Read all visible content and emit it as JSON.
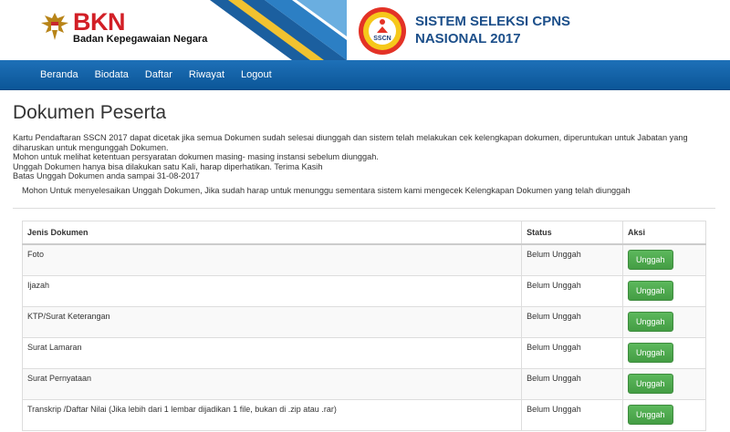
{
  "header": {
    "brand": "BKN",
    "brand_sub": "Badan Kepegawaian Negara",
    "sscn_logo_text": "SSCN",
    "title_line1": "SISTEM SELEKSI CPNS",
    "title_line2": "NASIONAL 2017"
  },
  "nav": {
    "items": [
      "Beranda",
      "Biodata",
      "Daftar",
      "Riwayat",
      "Logout"
    ]
  },
  "page": {
    "title": "Dokumen Peserta",
    "intro": [
      "Kartu Pendaftaran SSCN 2017 dapat dicetak jika semua Dokumen sudah selesai diunggah dan sistem telah melakukan cek kelengkapan dokumen, diperuntukan untuk Jabatan yang diharuskan untuk mengunggah Dokumen.",
      "Mohon untuk melihat ketentuan persyaratan dokumen masing- masing instansi sebelum diunggah.",
      "Unggah Dokumen hanya bisa dilakukan satu Kali, harap diperhatikan. Terima Kasih",
      "Batas Unggah Dokumen anda sampai 31-08-2017"
    ],
    "notice": "Mohon Untuk menyelesaikan Unggah Dokumen, Jika sudah harap untuk menunggu sementara sistem kami mengecek Kelengkapan Dokumen yang telah diunggah"
  },
  "table": {
    "headers": [
      "Jenis Dokumen",
      "Status",
      "Aksi"
    ],
    "rows": [
      {
        "doc": "Foto",
        "status": "Belum Unggah",
        "action": "Unggah"
      },
      {
        "doc": "Ijazah",
        "status": "Belum Unggah",
        "action": "Unggah"
      },
      {
        "doc": "KTP/Surat Keterangan",
        "status": "Belum Unggah",
        "action": "Unggah"
      },
      {
        "doc": "Surat Lamaran",
        "status": "Belum Unggah",
        "action": "Unggah"
      },
      {
        "doc": "Surat Pernyataan",
        "status": "Belum Unggah",
        "action": "Unggah"
      },
      {
        "doc": "Transkrip /Daftar Nilai (Jika lebih dari 1 lembar dijadikan 1 file, bukan di .zip atau .rar)",
        "status": "Belum Unggah",
        "action": "Unggah"
      }
    ]
  },
  "colors": {
    "nav_bg": "#1465ab",
    "brand_red": "#d21f26",
    "title_blue": "#1c4f8a",
    "button_green": "#4cae4c"
  }
}
